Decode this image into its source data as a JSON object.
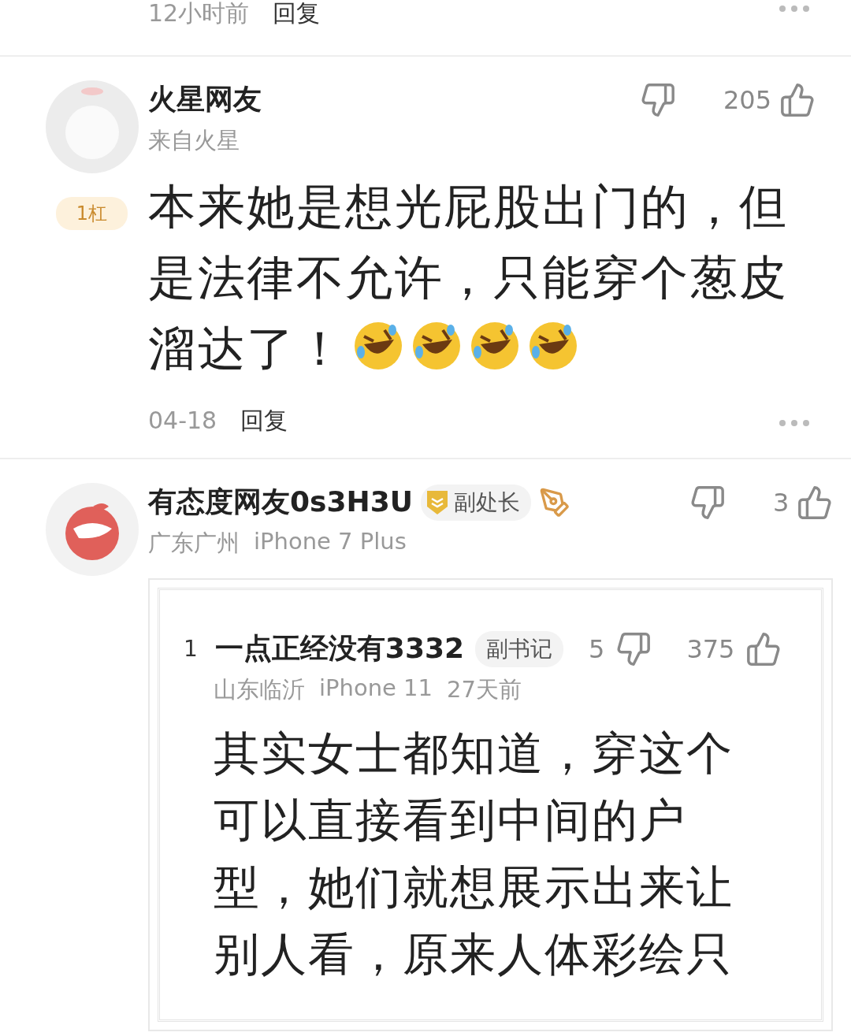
{
  "previous_footer": {
    "time": "12小时前",
    "reply": "回复"
  },
  "comments": [
    {
      "avatar": {
        "kind": "mascot"
      },
      "name": "火星网友",
      "meta": [
        "来自火星"
      ],
      "rank_badge": "1杠",
      "likes": "205",
      "text": "本来她是想光屁股出门的，但是法律不允许，只能穿个葱皮溜达了！",
      "reactions": [
        {
          "kind": "rofl"
        },
        {
          "kind": "rofl"
        },
        {
          "kind": "rofl"
        },
        {
          "kind": "rofl"
        }
      ],
      "time": "04-18",
      "reply": "回复"
    },
    {
      "avatar": {
        "kind": "logo"
      },
      "name": "有态度网友0s3H3U",
      "meta": [
        "广东广州",
        "iPhone 7 Plus"
      ],
      "title_badges": [
        {
          "kind": "rank",
          "label": "副处长"
        },
        {
          "kind": "pen"
        }
      ],
      "likes": "3",
      "quote": {
        "floor": "1",
        "name": "一点正经没有3332",
        "badge": "副书记",
        "dislikes": "5",
        "likes": "375",
        "meta": [
          "山东临沂",
          "iPhone 11",
          "27天前"
        ],
        "text": "其实女士都知道，穿这个可以直接看到中间的户型，她们就想展示出来让别人看，原来人体彩绘只"
      }
    }
  ]
}
